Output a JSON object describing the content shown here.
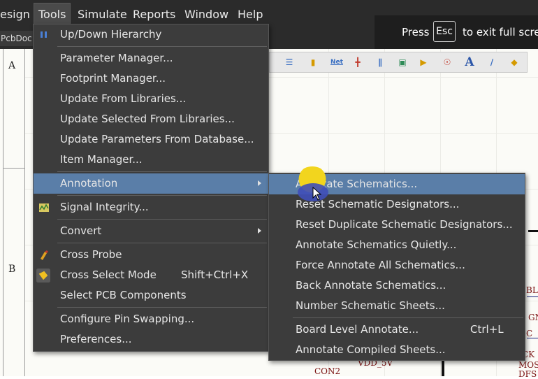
{
  "menubar": {
    "items": [
      "esign",
      "Tools",
      "Simulate",
      "Reports",
      "Window",
      "Help"
    ]
  },
  "banner": {
    "press": "Press",
    "key": "Esc",
    "tail": "to exit full scree"
  },
  "doc_tab": {
    "label": "PcbDoc"
  },
  "frame": {
    "zone_a": "A",
    "zone_b": "B"
  },
  "schematic": {
    "labels": [
      "BL",
      "GN",
      "C",
      "CK",
      "MOS",
      "DFS",
      "VDD_5V",
      "CON2"
    ],
    "toolbar_icons": [
      "align-icon",
      "part-icon",
      "netlabel-icon",
      "power-port-icon",
      "bus-icon",
      "component-icon",
      "port-icon",
      "probe-icon",
      "text-icon",
      "line-icon",
      "junction-icon"
    ],
    "toolbar_text": {
      "net": "Net",
      "text": "A"
    }
  },
  "tools_menu": {
    "items": [
      {
        "label": "Up/Down Hierarchy",
        "icon": "hierarchy-icon"
      },
      {
        "label": "Parameter Manager..."
      },
      {
        "label": "Footprint Manager..."
      },
      {
        "label": "Update From Libraries..."
      },
      {
        "label": "Update Selected From Libraries..."
      },
      {
        "label": "Update Parameters From Database..."
      },
      {
        "label": "Item Manager..."
      },
      {
        "label": "Annotation",
        "submenu": true
      },
      {
        "label": "Signal Integrity...",
        "icon": "signal-integrity-icon"
      },
      {
        "label": "Convert",
        "submenu": true
      },
      {
        "label": "Cross Probe",
        "icon": "cross-probe-icon"
      },
      {
        "label": "Cross Select Mode",
        "shortcut": "Shift+Ctrl+X",
        "icon": "cross-select-icon"
      },
      {
        "label": "Select PCB Components"
      },
      {
        "label": "Configure Pin Swapping..."
      },
      {
        "label": "Preferences..."
      }
    ]
  },
  "annotation_menu": {
    "items": [
      {
        "label": "Annotate Schematics..."
      },
      {
        "label": "Reset Schematic Designators..."
      },
      {
        "label": "Reset Duplicate Schematic Designators..."
      },
      {
        "label": "Annotate Schematics Quietly..."
      },
      {
        "label": "Force Annotate All Schematics..."
      },
      {
        "label": "Back Annotate Schematics..."
      },
      {
        "label": "Number Schematic Sheets..."
      },
      {
        "label": "Board Level Annotate...",
        "shortcut": "Ctrl+L"
      },
      {
        "label": "Annotate Compiled Sheets..."
      }
    ]
  },
  "colors": {
    "highlight": "#5a7ea8",
    "menu_bg": "#3c3c3c",
    "menubar_bg": "#2b2b2b"
  }
}
